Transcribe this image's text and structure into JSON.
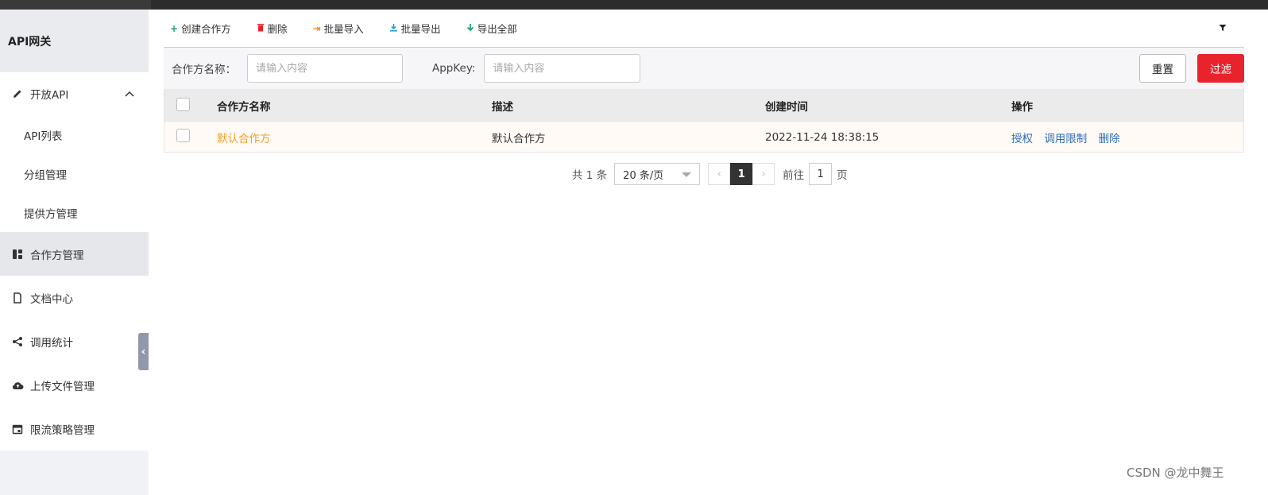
{
  "app": {
    "title": "API网关"
  },
  "sidebar": {
    "open_group": {
      "label": "开放API"
    },
    "sub_items": [
      {
        "label": "API列表"
      },
      {
        "label": "分组管理"
      },
      {
        "label": "提供方管理"
      }
    ],
    "items": [
      {
        "label": "合作方管理",
        "icon": "grid-icon",
        "active": true
      },
      {
        "label": "文档中心",
        "icon": "document-icon"
      },
      {
        "label": "调用统计",
        "icon": "share-icon"
      },
      {
        "label": "上传文件管理",
        "icon": "cloud-upload-icon"
      },
      {
        "label": "限流策略管理",
        "icon": "calendar-icon"
      }
    ]
  },
  "toolbar": {
    "create": "创建合作方",
    "delete": "删除",
    "batch_import": "批量导入",
    "batch_export": "批量导出",
    "export_all": "导出全部"
  },
  "filter": {
    "partner_label": "合作方名称：",
    "partner_placeholder": "请输入内容",
    "appkey_label": "AppKey:",
    "appkey_placeholder": "请输入内容",
    "reset": "重置",
    "submit": "过滤"
  },
  "table": {
    "columns": [
      "合作方名称",
      "描述",
      "创建时间",
      "操作"
    ],
    "rows": [
      {
        "name": "默认合作方",
        "desc": "默认合作方",
        "created": "2022-11-24 18:38:15",
        "ops": [
          "授权",
          "调用限制",
          "删除"
        ]
      }
    ]
  },
  "pagination": {
    "total": "共 1 条",
    "page_size": "20 条/页",
    "current": "1",
    "goto_label": "前往",
    "goto_value": "1",
    "page_suffix": "页"
  },
  "watermark": "CSDN @龙中舞王",
  "colors": {
    "accent_red": "#e8232b",
    "link_blue": "#2d6db8",
    "name_orange": "#f0a02a"
  }
}
